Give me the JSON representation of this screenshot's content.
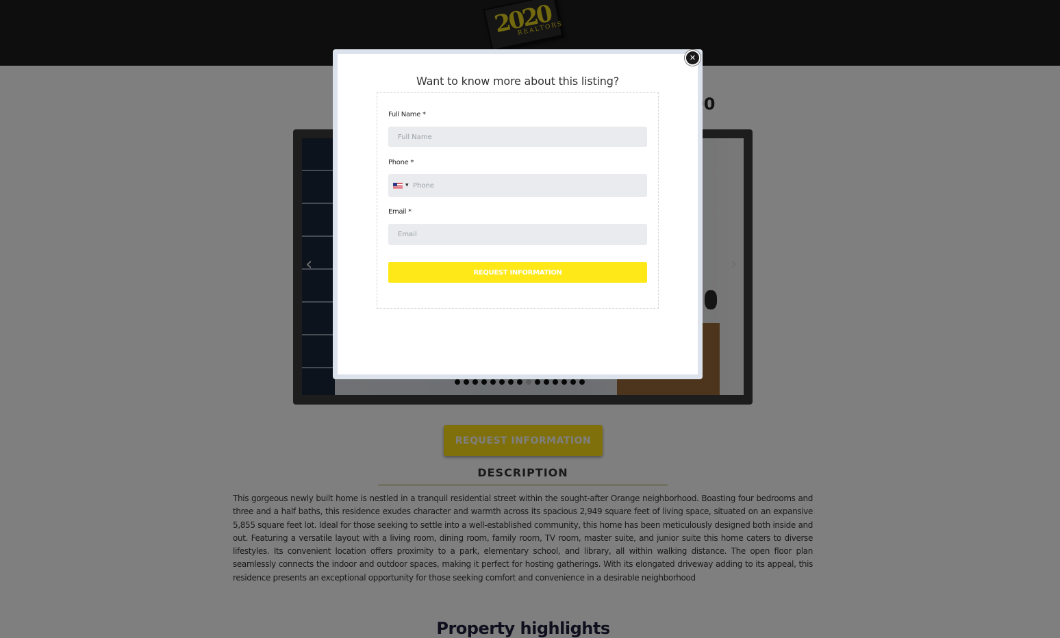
{
  "header": {
    "logo_text": "2020",
    "logo_subtext": "REALTORS"
  },
  "listing": {
    "price_visible_fragment": "00",
    "gallery": {
      "prev_icon": "chevron-left-icon",
      "next_icon": "chevron-right-icon",
      "dot_count": 15,
      "active_dot": 8
    },
    "request_button_label": "REQUEST INFORMATION",
    "description_title": "DESCRIPTION",
    "description_text": "This gorgeous newly built home is nestled in a tranquil residential street within the sought-after Orange neighborhood. Boasting four bedrooms and three and a half baths, this residence exudes character and warmth across its spacious 2,949 square feet of living space, situated on an expansive 5,855 square feet lot. Ideal for those seeking to settle into a well-established community, this home has been meticulously designed both inside and out. Featuring a versatile layout with a living room, dining room, family room, TV room, master suite, and junior suite this home caters to diverse lifestyles. Its convenient location offers proximity to a park, elementary school, and library, all within walking distance. The open floor plan seamlessly connects the indoor and outdoor spaces, making it perfect for hosting gatherings. With its elongated driveway adding to its appeal, this residence presents an exceptional opportunity for those seeking comfort and convenience in a desirable neighborhood",
    "highlights_title": "Property highlights"
  },
  "modal": {
    "title": "Want to know more about this listing?",
    "close_icon": "close-icon",
    "fields": {
      "full_name": {
        "label": "Full Name *",
        "placeholder": "Full Name",
        "value": ""
      },
      "phone": {
        "label": "Phone *",
        "placeholder": "Phone",
        "value": "",
        "country_flag": "us-flag-icon"
      },
      "email": {
        "label": "Email *",
        "placeholder": "Email",
        "value": ""
      }
    },
    "submit_label": "REQUEST INFORMATION"
  },
  "colors": {
    "accent_yellow": "#ffe817",
    "header_bg": "#1c1c1c",
    "input_bg": "#e9ebee"
  }
}
